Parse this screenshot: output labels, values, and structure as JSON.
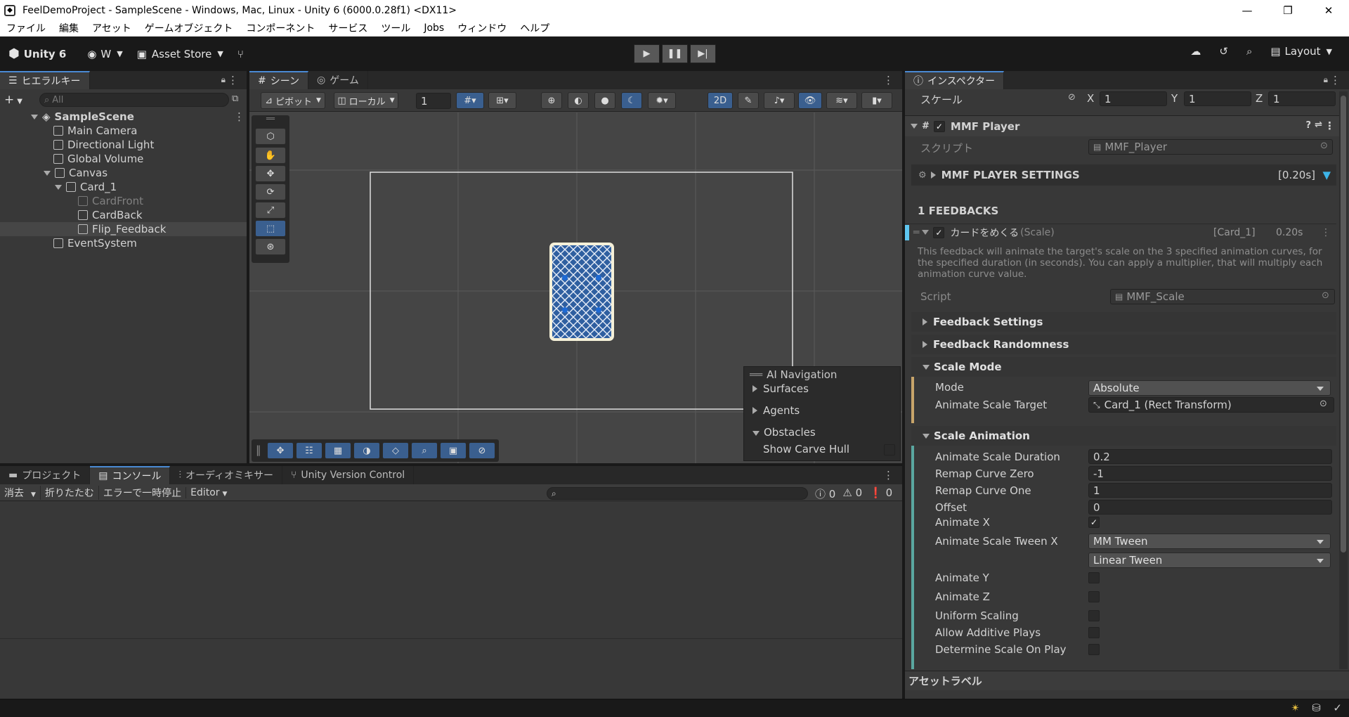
{
  "window": {
    "title": "FeelDemoProject - SampleScene - Windows, Mac, Linux - Unity 6 (6000.0.28f1) <DX11>"
  },
  "menu": [
    "ファイル",
    "編集",
    "アセット",
    "ゲームオブジェクト",
    "コンポーネント",
    "サービス",
    "ツール",
    "Jobs",
    "ウィンドウ",
    "ヘルプ"
  ],
  "toolbar": {
    "unity_label": "Unity 6",
    "account_label": "W",
    "asset_store_label": "Asset Store",
    "layout_label": "Layout"
  },
  "hierarchy": {
    "tab": "ヒエラルキー",
    "search_placeholder": "All",
    "scene": "SampleScene",
    "items": [
      {
        "label": "Main Camera",
        "depth": 1
      },
      {
        "label": "Directional Light",
        "depth": 1
      },
      {
        "label": "Global Volume",
        "depth": 1
      },
      {
        "label": "Canvas",
        "depth": 1
      },
      {
        "label": "Card_1",
        "depth": 2
      },
      {
        "label": "CardFront",
        "depth": 3
      },
      {
        "label": "CardBack",
        "depth": 3
      },
      {
        "label": "Flip_Feedback",
        "depth": 3
      },
      {
        "label": "EventSystem",
        "depth": 1
      }
    ]
  },
  "scene_view": {
    "tabs": [
      "シーン",
      "ゲーム"
    ],
    "pivot_label": "ピボット",
    "local_label": "ローカル",
    "grid_value": "1",
    "mode_2d": "2D",
    "ai_nav": {
      "title": "AI Navigation",
      "items": [
        "Surfaces",
        "Agents",
        "Obstacles"
      ],
      "show_carve_hull": "Show Carve Hull"
    }
  },
  "console": {
    "tabs": [
      "プロジェクト",
      "コンソール",
      "オーディオミキサー",
      "Unity Version Control"
    ],
    "clear": "消去",
    "collapse": "折りたたむ",
    "error_pause": "エラーで一時停止",
    "editor": "Editor",
    "count_info": "0",
    "count_warn": "0",
    "count_err": "0"
  },
  "inspector": {
    "tab": "インスペクター",
    "scale_label": "スケール",
    "scale_x": "1",
    "scale_y": "1",
    "scale_z": "1",
    "component_title": "MMF Player",
    "script_label": "スクリプト",
    "script_value": "MMF_Player",
    "player_settings": "MMF PLAYER SETTINGS",
    "player_duration": "[0.20s]",
    "feedbacks_count": "1 FEEDBACKS",
    "feedback_name": "カードをめくる",
    "feedback_type": "(Scale)",
    "feedback_target": "[Card_1]",
    "feedback_time": "0.20s",
    "description": "This feedback will animate the target's scale on the 3 specified animation curves, for the specified duration (in seconds). You can apply a multiplier, that will multiply each animation curve value.",
    "script2_label": "Script",
    "script2_value": "MMF_Scale",
    "feedback_settings": "Feedback Settings",
    "feedback_randomness": "Feedback Randomness",
    "scale_mode": "Scale Mode",
    "mode_label": "Mode",
    "mode_value": "Absolute",
    "target_label": "Animate Scale Target",
    "target_value": "Card_1 (Rect Transform)",
    "scale_animation": "Scale Animation",
    "duration_label": "Animate Scale Duration",
    "duration_value": "0.2",
    "remap_zero_label": "Remap Curve Zero",
    "remap_zero_value": "-1",
    "remap_one_label": "Remap Curve One",
    "remap_one_value": "1",
    "offset_label": "Offset",
    "offset_value": "0",
    "animate_x": "Animate X",
    "tween_x_label": "Animate Scale Tween X",
    "tween_x_value": "MM Tween",
    "tween_curve_value": "Linear Tween",
    "animate_y": "Animate Y",
    "animate_z": "Animate Z",
    "uniform": "Uniform Scaling",
    "additive": "Allow Additive Plays",
    "determine": "Determine Scale On Play",
    "asset_labels": "アセットラベル"
  }
}
